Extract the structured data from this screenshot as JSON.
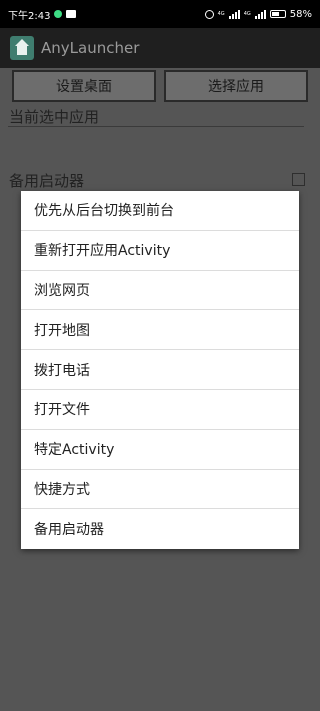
{
  "status_bar": {
    "time": "下午2:43",
    "network_a": "4G",
    "network_b": "4G",
    "battery_percent": "58",
    "battery_level": 0.58
  },
  "app_bar": {
    "title": "AnyLauncher",
    "icon": "home-icon"
  },
  "buttons": {
    "set_desktop": "设置桌面",
    "choose_app": "选择应用"
  },
  "current_app": {
    "label": "当前选中应用"
  },
  "backup_launcher": {
    "label": "备用启动器",
    "checked": false
  },
  "menu": {
    "items": [
      "优先从后台切换到前台",
      "重新打开应用Activity",
      "浏览网页",
      "打开地图",
      "拨打电话",
      "打开文件",
      "特定Activity",
      "快捷方式",
      "备用启动器"
    ]
  }
}
